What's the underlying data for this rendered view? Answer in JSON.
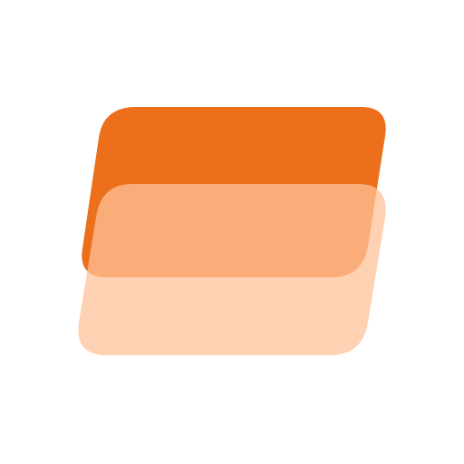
{
  "logo": {
    "icon": "stacked-cards-logo-icon",
    "colors": {
      "back_card": "#EC701B",
      "front_card": "#FFC299",
      "front_card_opacity": 0.75,
      "background": "#FFFFFF"
    }
  }
}
